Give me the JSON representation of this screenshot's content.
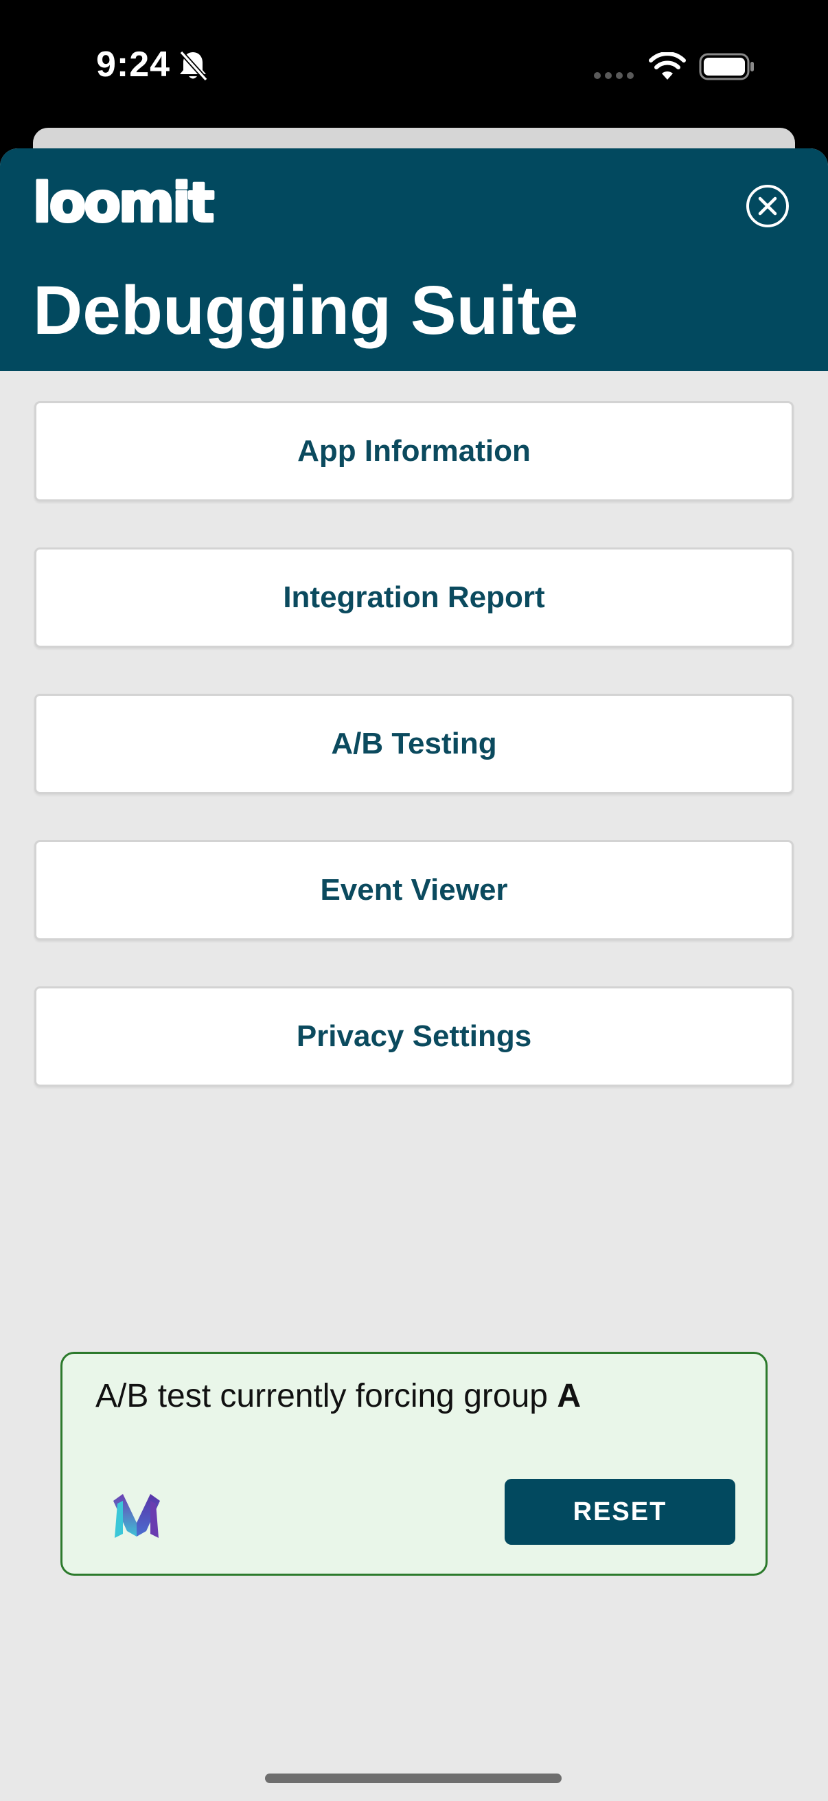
{
  "status_bar": {
    "time": "9:24",
    "icons": [
      "bell-slash-icon",
      "signal-dots-icon",
      "wifi-icon",
      "battery-icon"
    ]
  },
  "header": {
    "logo_text": "loomit",
    "title": "Debugging Suite",
    "close_icon": "close-circle-icon"
  },
  "menu": {
    "items": [
      {
        "label": "App Information"
      },
      {
        "label": "Integration Report"
      },
      {
        "label": "A/B Testing"
      },
      {
        "label": "Event Viewer"
      },
      {
        "label": "Privacy Settings"
      }
    ]
  },
  "ab_notice": {
    "message": "A/B test currently forcing group ",
    "group": "A",
    "button_label": "RESET",
    "logo_icon": "m-logo-icon"
  },
  "colors": {
    "header_bg": "#02495f",
    "sheet_bg": "#e8e8e8",
    "button_text": "#0b4a5e",
    "notice_bg": "#e9f6e9",
    "notice_border": "#2c7a2c",
    "reset_bg": "#02495f"
  }
}
